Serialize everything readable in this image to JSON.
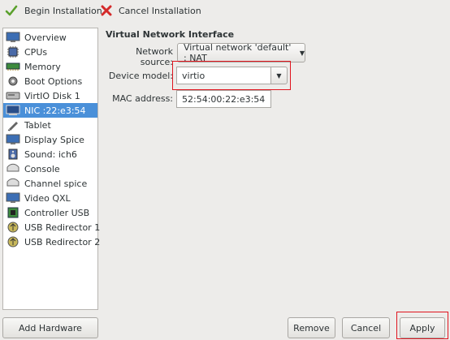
{
  "toolbar": {
    "begin_label": "Begin Installation",
    "cancel_label": "Cancel Installation"
  },
  "sidebar": {
    "items": [
      {
        "label": "Overview",
        "icon": "overview-icon"
      },
      {
        "label": "CPUs",
        "icon": "cpu-icon"
      },
      {
        "label": "Memory",
        "icon": "memory-icon"
      },
      {
        "label": "Boot Options",
        "icon": "boot-options-icon"
      },
      {
        "label": "VirtIO Disk 1",
        "icon": "disk-icon"
      },
      {
        "label": "NIC :22:e3:54",
        "icon": "nic-icon",
        "selected": true
      },
      {
        "label": "Tablet",
        "icon": "tablet-icon"
      },
      {
        "label": "Display Spice",
        "icon": "display-icon"
      },
      {
        "label": "Sound: ich6",
        "icon": "sound-icon"
      },
      {
        "label": "Console",
        "icon": "console-icon"
      },
      {
        "label": "Channel spice",
        "icon": "channel-icon"
      },
      {
        "label": "Video QXL",
        "icon": "video-icon"
      },
      {
        "label": "Controller USB",
        "icon": "controller-icon"
      },
      {
        "label": "USB Redirector 1",
        "icon": "usb-redirector-icon"
      },
      {
        "label": "USB Redirector 2",
        "icon": "usb-redirector-icon"
      }
    ],
    "add_hardware_label": "Add Hardware"
  },
  "detail": {
    "section_title": "Virtual Network Interface",
    "network_source_label": "Network source:",
    "network_source_value": "Virtual network 'default' : NAT",
    "device_model_label": "Device model:",
    "device_model_value": "virtio",
    "mac_label": "MAC address:",
    "mac_value": "52:54:00:22:e3:54"
  },
  "footer": {
    "remove_label": "Remove",
    "cancel_label": "Cancel",
    "apply_label": "Apply"
  },
  "colors": {
    "selection": "#4a90d9",
    "highlight_box": "#e0141e"
  }
}
